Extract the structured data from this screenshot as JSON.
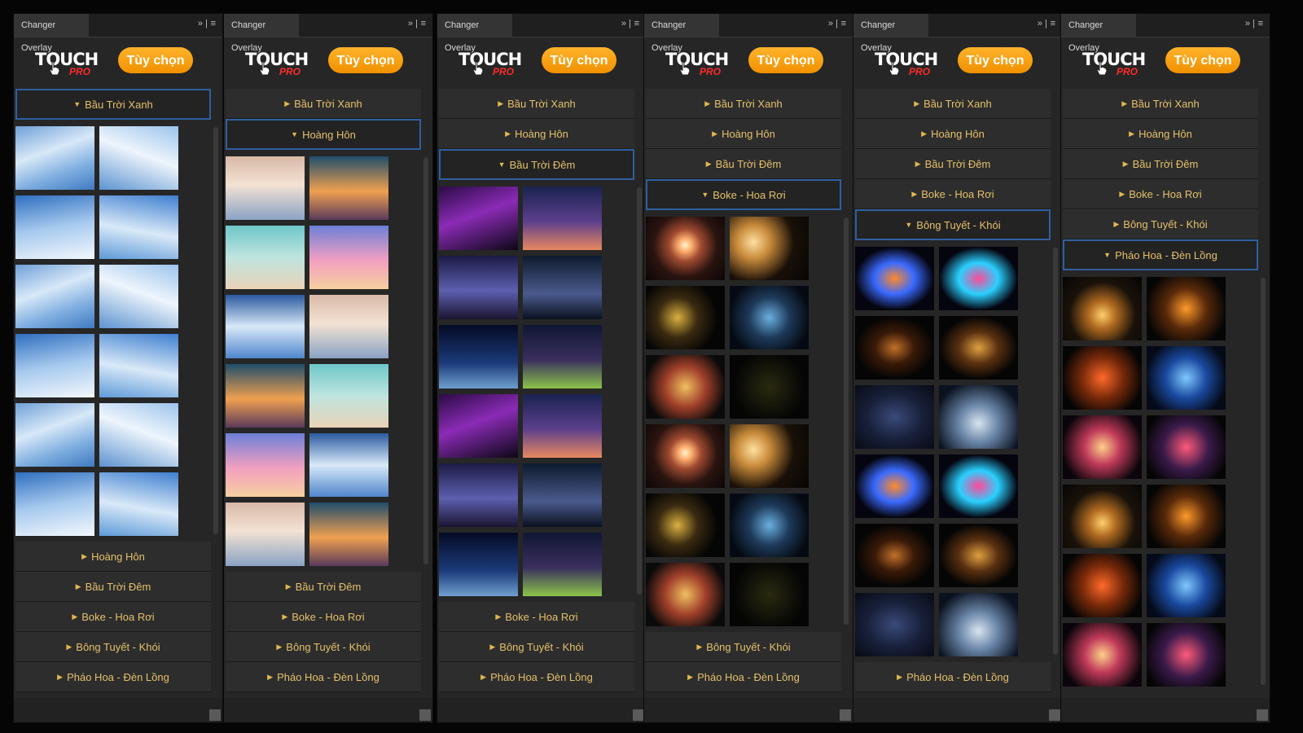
{
  "panels": [
    {
      "title": "Changer Overlay",
      "options_label": "Tùy chọn",
      "logo": {
        "brand": "TOUCH",
        "sub": "PRO"
      },
      "categories_before": [
        "Bầu Trời Xanh"
      ],
      "active_label": "Bầu Trời Xanh",
      "categories_after": [
        "Hoàng Hôn",
        "Bầu Trời Đêm",
        "Boke - Hoa Rơi",
        "Bông Tuyết - Khói",
        "Pháo Hoa - Đèn Lồng"
      ],
      "theme": "sky"
    },
    {
      "title": "Changer Overlay",
      "options_label": "Tùy chọn",
      "logo": {
        "brand": "TOUCH",
        "sub": "PRO"
      },
      "categories_before": [
        "Bầu Trời Xanh",
        "Hoàng Hôn"
      ],
      "active_label": "Hoàng Hôn",
      "categories_after": [
        "Bầu Trời Đêm",
        "Boke - Hoa Rơi",
        "Bông Tuyết - Khói",
        "Pháo Hoa - Đèn Lồng"
      ],
      "theme": "sunset"
    },
    {
      "title": "Changer Overlay",
      "options_label": "Tùy chọn",
      "logo": {
        "brand": "TOUCH",
        "sub": "PRO"
      },
      "categories_before": [
        "Bầu Trời Xanh",
        "Hoàng Hôn",
        "Bầu Trời Đêm"
      ],
      "active_label": "Bầu Trời Đêm",
      "categories_after": [
        "Boke - Hoa Rơi",
        "Bông Tuyết - Khói",
        "Pháo Hoa - Đèn Lồng"
      ],
      "theme": "night"
    },
    {
      "title": "Changer Overlay",
      "options_label": "Tùy chọn",
      "logo": {
        "brand": "TOUCH",
        "sub": "PRO"
      },
      "categories_before": [
        "Bầu Trời Xanh",
        "Hoàng Hôn",
        "Bầu Trời Đêm",
        "Boke - Hoa Rơi"
      ],
      "active_label": "Boke - Hoa Rơi",
      "categories_after": [
        "Bông Tuyết - Khói",
        "Pháo Hoa - Đèn Lồng"
      ],
      "theme": "bokeh"
    },
    {
      "title": "Changer Overlay",
      "options_label": "Tùy chọn",
      "logo": {
        "brand": "TOUCH",
        "sub": "PRO"
      },
      "categories_before": [
        "Bầu Trời Xanh",
        "Hoàng Hôn",
        "Bầu Trời Đêm",
        "Boke - Hoa Rơi",
        "Bông Tuyết - Khói"
      ],
      "active_label": "Bông Tuyết - Khói",
      "categories_after": [
        "Pháo Hoa - Đèn Lồng"
      ],
      "theme": "smoke"
    },
    {
      "title": "Changer Overlay",
      "options_label": "Tùy chọn",
      "logo": {
        "brand": "TOUCH",
        "sub": "PRO"
      },
      "categories_before": [
        "Bầu Trời Xanh",
        "Hoàng Hôn",
        "Bầu Trời Đêm",
        "Boke - Hoa Rơi",
        "Bông Tuyết - Khói",
        "Pháo Hoa - Đèn Lồng"
      ],
      "active_label": "Pháo Hoa - Đèn Lồng",
      "categories_after": [],
      "theme": "fireworks"
    }
  ],
  "colors": {
    "accent_button": "#f5a00f",
    "category_text": "#e4c06a",
    "active_border": "#2f5fa0",
    "panel_bg": "#262626"
  },
  "icons": {
    "collapse": "double-chevron-icon",
    "menu": "hamburger-menu-icon",
    "expand": "triangle-right-icon",
    "expanded": "triangle-down-icon"
  }
}
